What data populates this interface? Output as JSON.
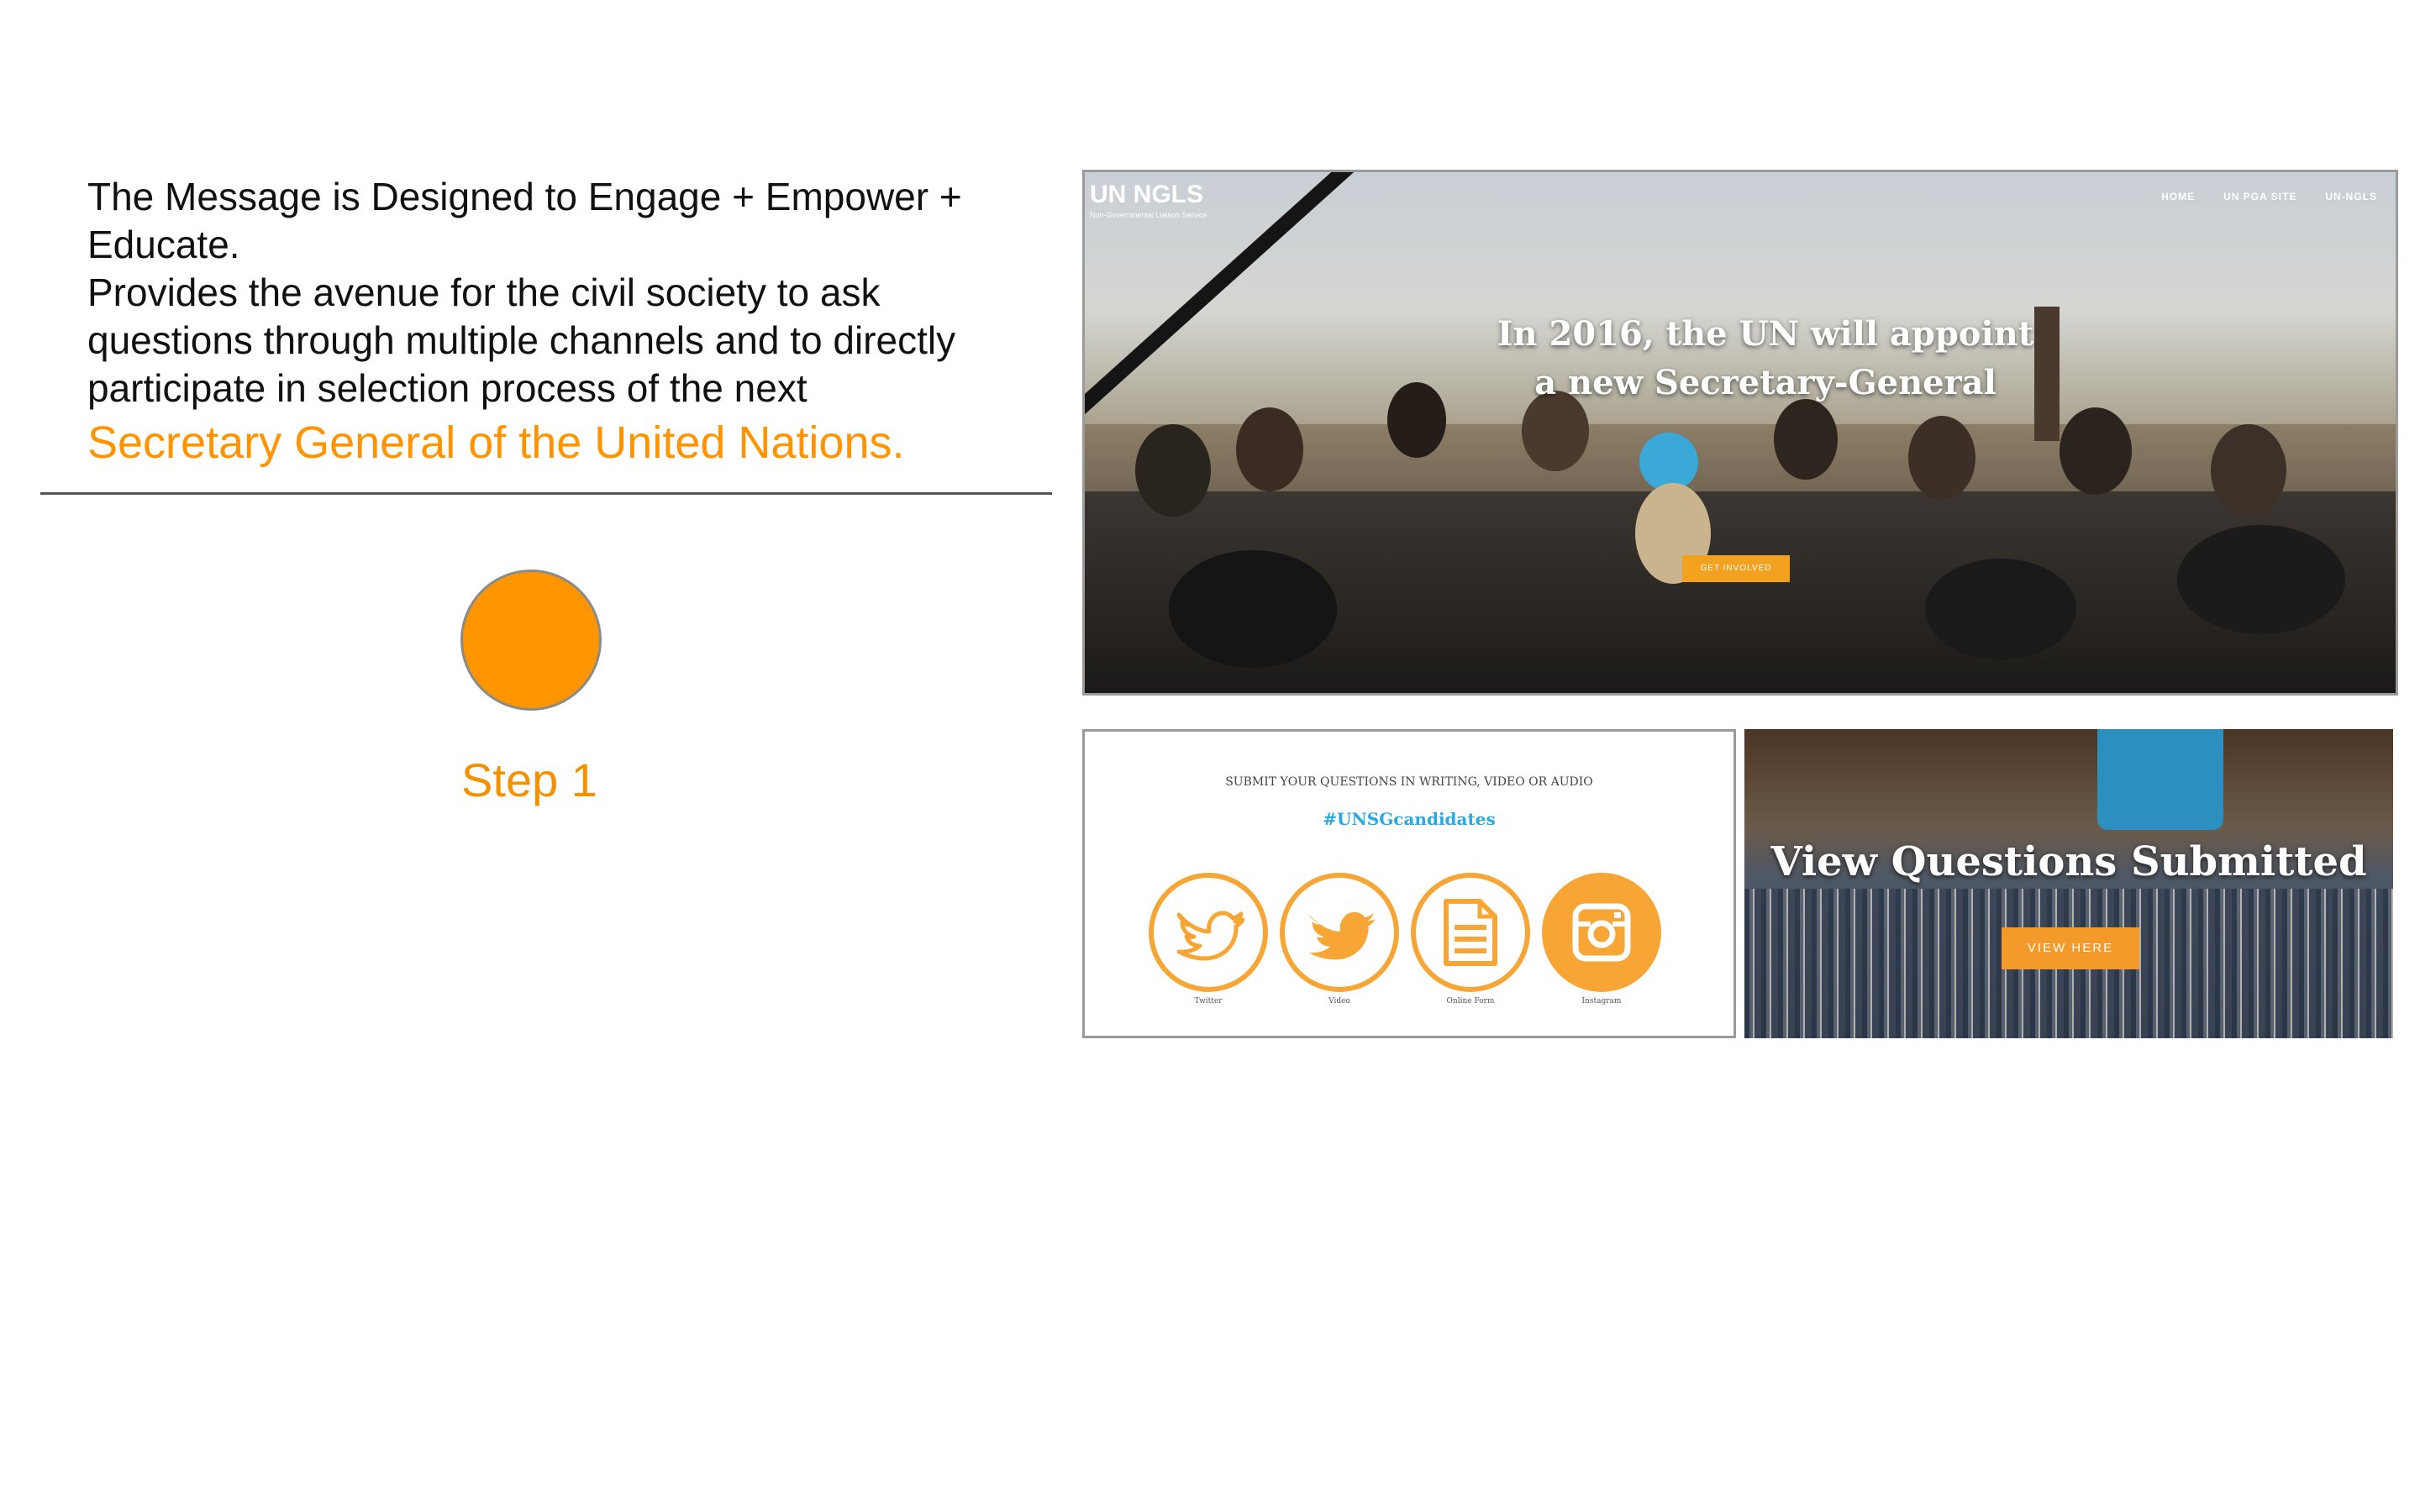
{
  "intro": {
    "line1": "The Message is Designed to Engage + Empower + Educate.",
    "line2": "Provides the avenue for the civil society to ask questions through multiple channels and to directly participate in selection process of the next",
    "highlight": "Secretary General of the United Nations."
  },
  "step": {
    "label": "Step 1",
    "color": "#ff9600"
  },
  "hero": {
    "logo": "UN NGLS",
    "logo_sub": "Non-Governmental Liaison Service",
    "nav": [
      "HOME",
      "UN PGA SITE",
      "UN-NGLS"
    ],
    "headline_line1": "In 2016, the UN will appoint",
    "headline_line2": "a new Secretary-General",
    "cta": "GET INVOLVED"
  },
  "social": {
    "subtitle": "SUBMIT YOUR QUESTIONS IN WRITING, VIDEO OR AUDIO",
    "hashtag": "#UNSGcandidates",
    "items": [
      {
        "label": "Twitter",
        "icon": "twitter-bird-icon"
      },
      {
        "label": "Video",
        "icon": "twitter-bird-filled-icon"
      },
      {
        "label": "Online Form",
        "icon": "document-icon"
      },
      {
        "label": "Instagram",
        "icon": "instagram-icon"
      }
    ]
  },
  "questions": {
    "title": "View Questions Submitted",
    "button": "VIEW HERE"
  },
  "colors": {
    "accent": "#f7a635",
    "hashtag": "#29a9e1",
    "highlight": "#ff9400"
  }
}
